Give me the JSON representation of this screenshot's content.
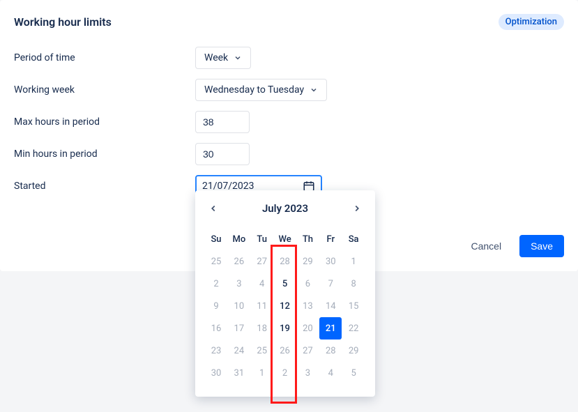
{
  "header": {
    "title": "Working hour limits",
    "badge": "Optimization"
  },
  "form": {
    "period_label": "Period of time",
    "period_value": "Week",
    "week_label": "Working week",
    "week_value": "Wednesday to Tuesday",
    "max_label": "Max hours in period",
    "max_value": "38",
    "min_label": "Min hours in period",
    "min_value": "30",
    "started_label": "Started",
    "started_value": "21/07/2023"
  },
  "datepicker": {
    "month_label": "July 2023",
    "dow": [
      "Su",
      "Mo",
      "Tu",
      "We",
      "Th",
      "Fr",
      "Sa"
    ],
    "rows": [
      [
        {
          "d": "25",
          "muted": true
        },
        {
          "d": "26",
          "muted": true
        },
        {
          "d": "27",
          "muted": true
        },
        {
          "d": "28",
          "muted": true
        },
        {
          "d": "29",
          "muted": true
        },
        {
          "d": "30",
          "muted": true
        },
        {
          "d": "1",
          "muted": true
        }
      ],
      [
        {
          "d": "2",
          "muted": true
        },
        {
          "d": "3",
          "muted": true
        },
        {
          "d": "4",
          "muted": true
        },
        {
          "d": "5",
          "muted": false
        },
        {
          "d": "6",
          "muted": true
        },
        {
          "d": "7",
          "muted": true
        },
        {
          "d": "8",
          "muted": true
        }
      ],
      [
        {
          "d": "9",
          "muted": true
        },
        {
          "d": "10",
          "muted": true
        },
        {
          "d": "11",
          "muted": true
        },
        {
          "d": "12",
          "muted": false
        },
        {
          "d": "13",
          "muted": true
        },
        {
          "d": "14",
          "muted": true
        },
        {
          "d": "15",
          "muted": true
        }
      ],
      [
        {
          "d": "16",
          "muted": true
        },
        {
          "d": "17",
          "muted": true
        },
        {
          "d": "18",
          "muted": true
        },
        {
          "d": "19",
          "muted": false
        },
        {
          "d": "20",
          "muted": true
        },
        {
          "d": "21",
          "selected": true
        },
        {
          "d": "22",
          "muted": true
        }
      ],
      [
        {
          "d": "23",
          "muted": true
        },
        {
          "d": "24",
          "muted": true
        },
        {
          "d": "25",
          "muted": true
        },
        {
          "d": "26",
          "muted": true
        },
        {
          "d": "27",
          "muted": true
        },
        {
          "d": "28",
          "muted": true
        },
        {
          "d": "29",
          "muted": true
        }
      ],
      [
        {
          "d": "30",
          "muted": true
        },
        {
          "d": "31",
          "muted": true
        },
        {
          "d": "1",
          "muted": true
        },
        {
          "d": "2",
          "muted": true
        },
        {
          "d": "3",
          "muted": true
        },
        {
          "d": "4",
          "muted": true
        },
        {
          "d": "5",
          "muted": true
        }
      ]
    ]
  },
  "actions": {
    "cancel": "Cancel",
    "save": "Save"
  }
}
